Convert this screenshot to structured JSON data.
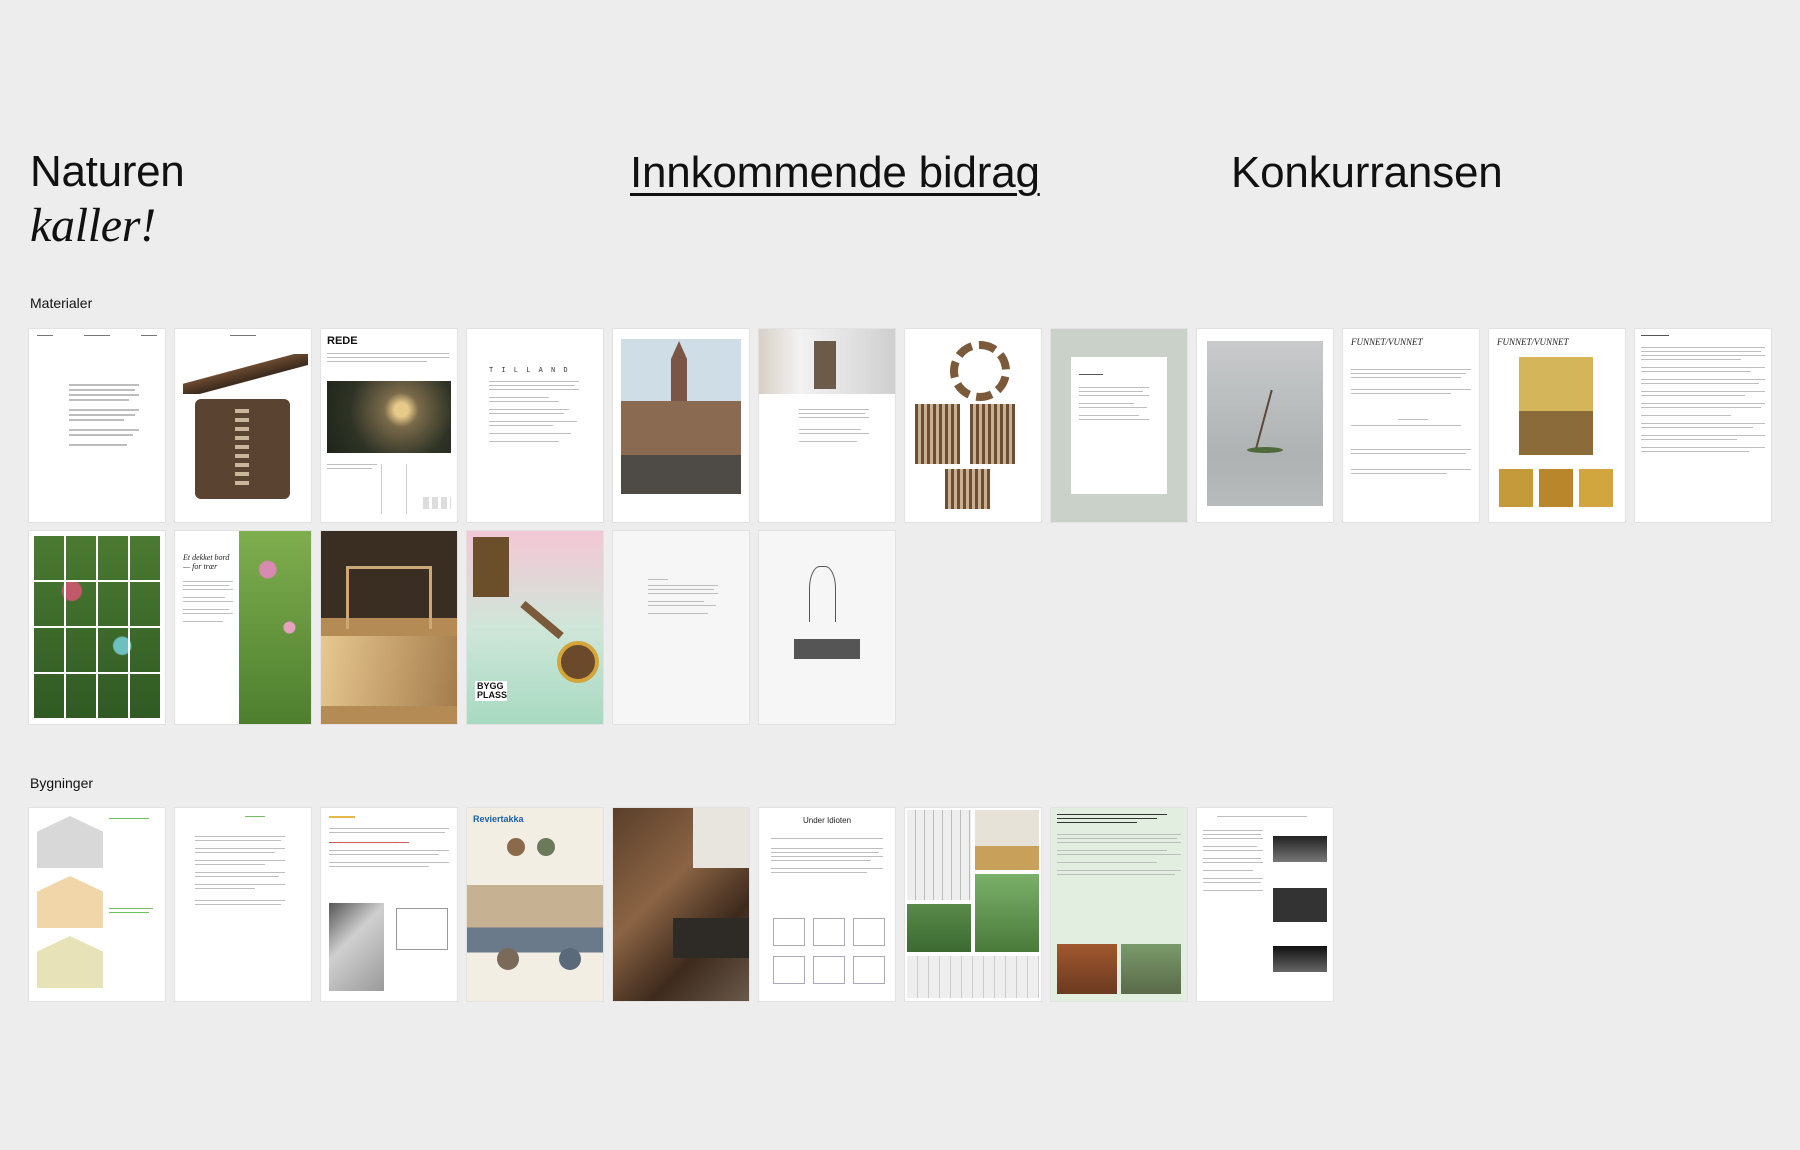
{
  "brand": {
    "line1": "Naturen",
    "line2": "kaller!"
  },
  "nav": {
    "incoming": "Innkommende bidrag",
    "competition": "Konkurransen"
  },
  "sections": {
    "materials": "Materialer",
    "buildings": "Bygninger"
  },
  "tile_text": {
    "rede": "REDE",
    "til_land": "T I L   L A N D",
    "funnet1": "FUNNET/VUNNET",
    "funnet2": "FUNNET/VUNNET",
    "under_idioten": "Under Idioten",
    "reviertakka": "Reviertakka",
    "et_dekket": "Et dekket bord — for trær",
    "bygg": "BYGG PLASS"
  },
  "colors": {
    "background": "#ededed",
    "tile": "#ffffff",
    "sage": "#c9d1c9",
    "green_accent": "#6fbf5a"
  }
}
